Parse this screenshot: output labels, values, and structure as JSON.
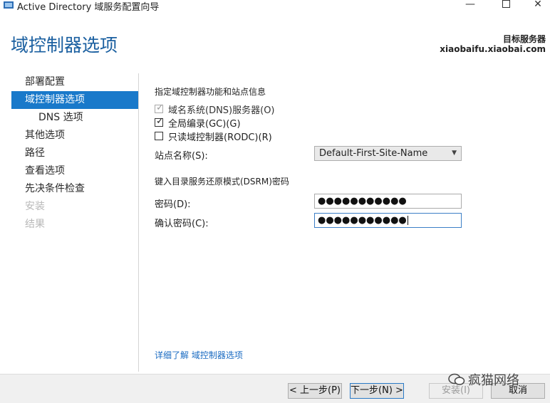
{
  "window": {
    "title": "Active Directory 域服务配置向导"
  },
  "header": {
    "page_title": "域控制器选项",
    "target_label": "目标服务器",
    "target_server": "xiaobaifu.xiaobai.com"
  },
  "sidebar": {
    "items": [
      {
        "label": "部署配置",
        "state": "normal"
      },
      {
        "label": "域控制器选项",
        "state": "active"
      },
      {
        "label": "DNS 选项",
        "state": "sub"
      },
      {
        "label": "其他选项",
        "state": "normal"
      },
      {
        "label": "路径",
        "state": "normal"
      },
      {
        "label": "查看选项",
        "state": "normal"
      },
      {
        "label": "先决条件检查",
        "state": "normal"
      },
      {
        "label": "安装",
        "state": "disabled"
      },
      {
        "label": "结果",
        "state": "disabled"
      }
    ]
  },
  "content": {
    "functions_heading": "指定域控制器功能和站点信息",
    "checkboxes": [
      {
        "label": "域名系统(DNS)服务器(O)",
        "checked": true,
        "disabled": true
      },
      {
        "label": "全局编录(GC)(G)",
        "checked": true,
        "disabled": false
      },
      {
        "label": "只读域控制器(RODC)(R)",
        "checked": false,
        "disabled": false
      }
    ],
    "site_label": "站点名称(S):",
    "site_value": "Default-First-Site-Name",
    "dsrm_heading": "键入目录服务还原模式(DSRM)密码",
    "password_label": "密码(D):",
    "password_value": "●●●●●●●●●●●",
    "confirm_label": "确认密码(C):",
    "confirm_value": "●●●●●●●●●●●",
    "help_link": "详细了解 域控制器选项"
  },
  "footer": {
    "back_label": "< 上一步(P)",
    "next_label": "下一步(N) >",
    "install_label": "安装(I)",
    "cancel_label": "取消"
  },
  "watermark": {
    "text": "疯猫网络"
  },
  "colors": {
    "accent": "#1979ca",
    "title_blue": "#1a5fa0",
    "link": "#1a6bc2"
  }
}
